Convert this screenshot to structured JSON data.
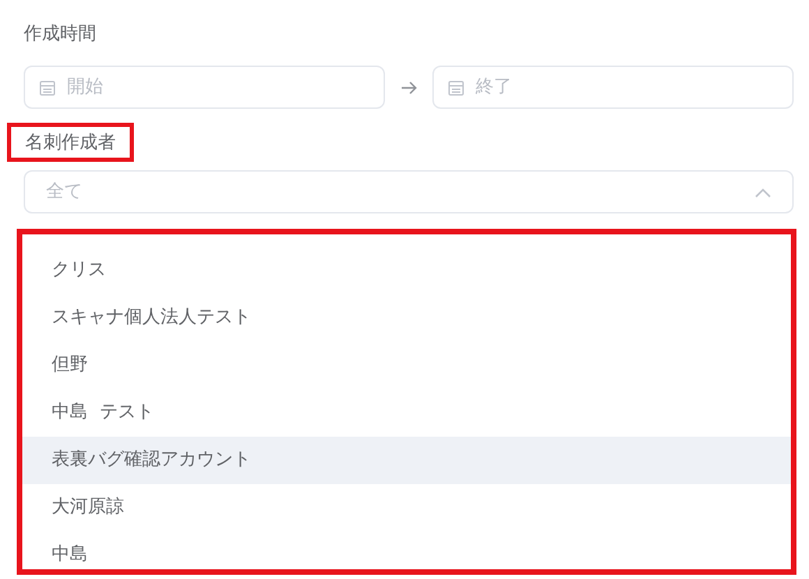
{
  "created_time": {
    "label": "作成時間",
    "start": {
      "placeholder": "開始"
    },
    "end": {
      "placeholder": "終了"
    }
  },
  "creator": {
    "label": "名刺作成者",
    "annotated": true,
    "select": {
      "placeholder": "全て",
      "expanded": true
    },
    "dropdown": {
      "annotated": true,
      "options": [
        {
          "label": "クリス",
          "highlighted": false
        },
        {
          "label": "スキャナ個人法人テスト",
          "highlighted": false
        },
        {
          "label": "但野",
          "highlighted": false
        },
        {
          "label": "中島  テスト",
          "highlighted": false
        },
        {
          "label": "表裏バグ確認アカウント",
          "highlighted": true
        },
        {
          "label": "大河原諒",
          "highlighted": false
        },
        {
          "label": "中島",
          "highlighted": false
        }
      ]
    }
  }
}
